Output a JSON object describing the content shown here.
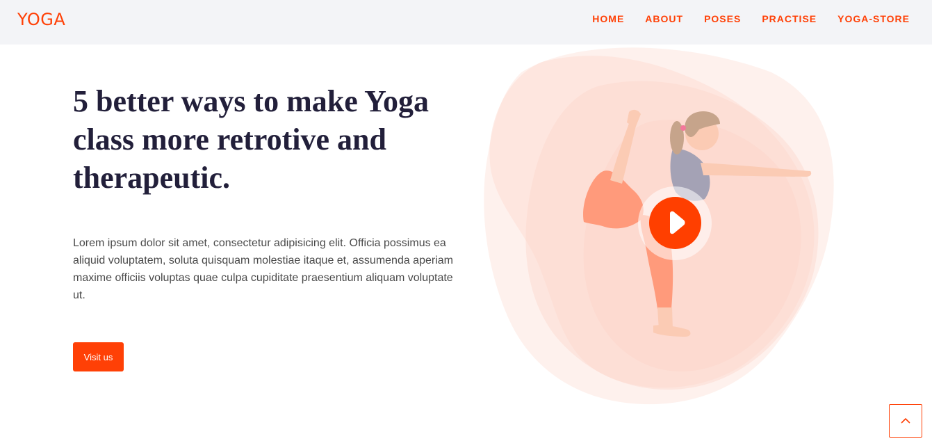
{
  "header": {
    "logo": "YOGA",
    "nav": [
      "HOME",
      "ABOUT",
      "POSES",
      "PRACTISE",
      "YOGA-STORE"
    ]
  },
  "hero": {
    "title": "5 better ways to make Yoga class more retrotive and therapeutic.",
    "body": "Lorem ipsum dolor sit amet, consectetur adipisicing elit. Officia possimus ea aliquid voluptatem, soluta quisquam molestiae itaque et, assumenda aperiam maxime officiis voluptas quae culpa cupiditate praesentium aliquam voluptate ut.",
    "button_label": "Visit us"
  },
  "icons": {
    "play": "play-icon",
    "scroll_top": "chevron-up-icon"
  },
  "colors": {
    "accent": "#ff4006",
    "title": "#221f3a",
    "header_bg": "#f3f4f7",
    "blob": "#fde4dc"
  }
}
